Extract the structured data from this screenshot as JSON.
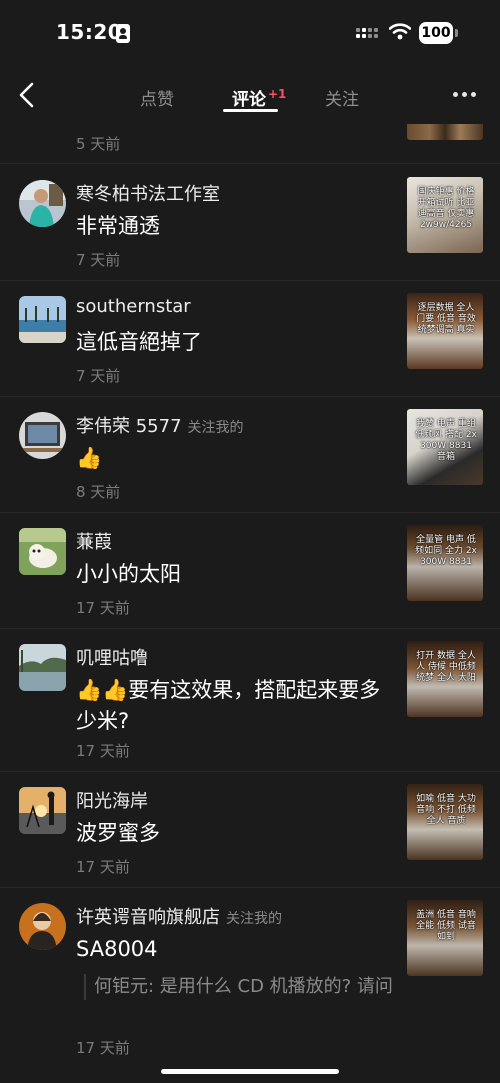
{
  "status_bar": {
    "time": "15:20",
    "battery": "100",
    "icons": [
      "id-card-icon",
      "signal-icon",
      "wifi-icon",
      "battery-icon"
    ]
  },
  "nav": {
    "back_icon": "chevron-left-icon",
    "tabs": [
      {
        "label": "点赞",
        "active": false
      },
      {
        "label": "评论",
        "active": true,
        "badge": "+1"
      },
      {
        "label": "关注",
        "active": false
      }
    ],
    "more_icon": "more-dots-icon"
  },
  "feed": {
    "partial_time": "5 天前",
    "comments": [
      {
        "username": "寒冬柏书法工作室",
        "follow_tag": "",
        "content": "非常通透",
        "time": "7 天前",
        "thumb_text": "国庆钜惠 价格 开箱试听 比亚迪高音 仅卖惠 2w9w/4265"
      },
      {
        "username": "southernstar",
        "follow_tag": "",
        "content": "這低音絕掉了",
        "time": "7 天前",
        "thumb_text": "逐层数据 全人门要 低音 音效 统梦调高 真实"
      },
      {
        "username": "李伟荣 5577",
        "follow_tag": "关注我的",
        "content": "👍",
        "time": "8 天前",
        "thumb_text": "我赞 电声 重组 低频风 搭配 2x300W 8831 音箱"
      },
      {
        "username": "蒹葭",
        "follow_tag": "",
        "content": "小小的太阳",
        "time": "17 天前",
        "thumb_text": "全量管 电声 低频如同 全力 2x300W 8831"
      },
      {
        "username": "叽哩咕噜",
        "follow_tag": "",
        "content": "👍👍要有这效果，搭配起来要多少米?",
        "time": "17 天前",
        "thumb_text": "打开 数据 全人 人 侍候 中低频 统梦 全人 太阳"
      },
      {
        "username": "阳光海岸",
        "follow_tag": "",
        "content": "波罗蜜多",
        "time": "17 天前",
        "thumb_text": "如喻 低音 大功 音响 不打 低频 全人 音质"
      },
      {
        "username": "许英谔音响旗舰店",
        "follow_tag": "关注我的",
        "content": "SA8004",
        "quote": "何钜元: 是用什么 CD 机播放的? 请问",
        "time": "17 天前",
        "thumb_text": "盖洲 低音 音响 全能 低频 试音 如到"
      }
    ]
  }
}
